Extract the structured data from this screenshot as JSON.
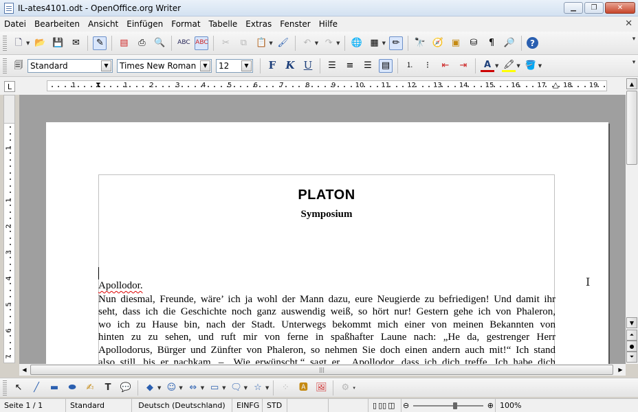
{
  "window": {
    "title": "IL-ates4101.odt - OpenOffice.org Writer",
    "minimize": "▁",
    "maximize": "❐",
    "close": "✕"
  },
  "menu": {
    "items": [
      "Datei",
      "Bearbeiten",
      "Ansicht",
      "Einfügen",
      "Format",
      "Tabelle",
      "Extras",
      "Fenster",
      "Hilfe"
    ],
    "doc_close": "✕"
  },
  "formatting": {
    "paragraph_style": "Standard",
    "font_name": "Times New Roman",
    "font_size": "12",
    "bold": "F",
    "italic": "K",
    "underline": "U",
    "font_color_label": "A"
  },
  "ruler": {
    "h_numbers": [
      "1",
      "1",
      "2",
      "3",
      "4",
      "5",
      "6",
      "7",
      "8",
      "9",
      "10",
      "11",
      "12",
      "13",
      "14",
      "15",
      "16",
      "17",
      "18",
      "19"
    ],
    "v_numbers": [
      "1",
      "1",
      "2",
      "3",
      "4",
      "5",
      "6",
      "7"
    ],
    "tab_type": "L"
  },
  "document": {
    "title": "PLATON",
    "subtitle": "Symposium",
    "speaker": "Apollodor.",
    "lines": [
      "Nun diesmal, Freunde, wäre’ ich ja wohl der Mann dazu, eure Neugierde zu befriedigen! Und damit ihr",
      "seht, dass ich die Geschichte noch ganz auswendig weiß, so hört nur! Gestern gehe ich von Phaleron,",
      "wo ich zu Hause bin, nach der Stadt. Unterwegs bekommt mich einer von meinen Bekannten von",
      "hinten zu zu sehen, und ruft mir von ferne in spaßhafter Laune nach: „He da, gestrenger Herr",
      "Apollodorus, Bürger und Zünfter von Phaleron, so nehmen Sie doch einen andern auch mit!“ Ich stand",
      "also still, bis er nachkam. – „Wie erwünscht,“ sagt er, „Apollodor, dass ich dich treffe. Ich habe dich"
    ]
  },
  "status": {
    "page": "Seite 1 / 1",
    "style": "Standard",
    "language": "Deutsch (Deutschland)",
    "insert_mode": "EINFG",
    "selection_mode": "STD",
    "zoom": "100%"
  },
  "colors": {
    "accent": "#6b8fc9",
    "spellcheck": "#dd0000",
    "doc_background": "#9f9f9f"
  }
}
